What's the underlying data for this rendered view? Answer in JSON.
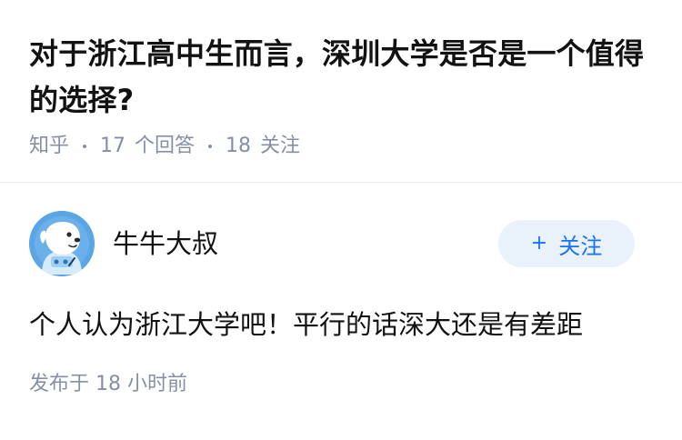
{
  "question": {
    "title": "对于浙江高中生而言，深圳大学是否是一个值得的选择?",
    "source": "知乎",
    "answer_count": "17",
    "answer_label": "个回答",
    "follow_count": "18",
    "follow_label": "关注"
  },
  "answer": {
    "author": {
      "name": "牛牛大叔",
      "avatar_icon": "cartoon-dog-avatar-icon",
      "avatar_bg": "#5aa5e6"
    },
    "follow_button": {
      "icon": "+",
      "label": "关注",
      "text_color": "#1772f6",
      "bg_color": "#e9f1fb"
    },
    "content": "个人认为浙江大学吧！平行的话深大还是有差距",
    "published_label": "发布于",
    "published_time": "18 小时前"
  },
  "colors": {
    "primary_text": "#121212",
    "secondary_text": "#8590a6",
    "divider": "#ebebeb"
  }
}
